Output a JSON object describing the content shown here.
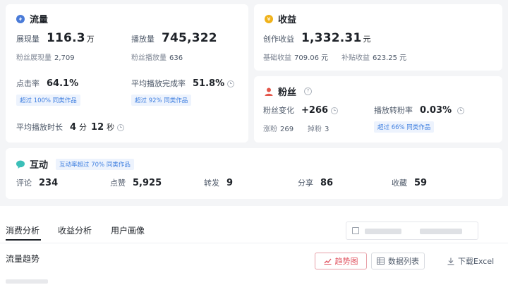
{
  "traffic": {
    "title": "流量",
    "impressions_label": "展现量",
    "impressions_value": "116.3",
    "impressions_unit": "万",
    "plays_label": "播放量",
    "plays_value": "745,322",
    "fan_impressions_label": "粉丝展现量",
    "fan_impressions_value": "2,709",
    "fan_plays_label": "粉丝播放量",
    "fan_plays_value": "636",
    "ctr_label": "点击率",
    "ctr_value": "64.1%",
    "ctr_badge": "超过 100% 同类作品",
    "completion_label": "平均播放完成率",
    "completion_value": "51.8%",
    "completion_badge": "超过 92% 同类作品",
    "avg_duration_label": "平均播放时长",
    "avg_duration_min": "4",
    "avg_duration_min_unit": "分",
    "avg_duration_sec": "12",
    "avg_duration_sec_unit": "秒"
  },
  "income": {
    "title": "收益",
    "creation_label": "创作收益",
    "creation_value": "1,332.31",
    "creation_unit": "元",
    "base_label": "基础收益",
    "base_value": "709.06 元",
    "subsidy_label": "补贴收益",
    "subsidy_value": "623.25 元"
  },
  "fans": {
    "title": "粉丝",
    "change_label": "粉丝变化",
    "change_value": "+266",
    "conversion_label": "播放转粉率",
    "conversion_value": "0.03%",
    "conversion_badge": "超过 66% 同类作品",
    "gain_label": "涨粉",
    "gain_value": "269",
    "loss_label": "掉粉",
    "loss_value": "3"
  },
  "interaction": {
    "title": "互动",
    "badge": "互动率超过 70% 同类作品",
    "items": [
      {
        "label": "评论",
        "value": "234"
      },
      {
        "label": "点赞",
        "value": "5,925"
      },
      {
        "label": "转发",
        "value": "9"
      },
      {
        "label": "分享",
        "value": "86"
      },
      {
        "label": "收藏",
        "value": "59"
      }
    ]
  },
  "tabs": [
    "消费分析",
    "收益分析",
    "用户画像"
  ],
  "trend": {
    "title": "流量趋势",
    "chart_button": "趋势图",
    "list_button": "数据列表",
    "download_button": "下载Excel"
  },
  "colors": {
    "traffic_icon": "#4a7bd8",
    "income_icon": "#f0b21a",
    "fans_icon": "#e4564a",
    "interaction_icon": "#3bbfb8",
    "badge_text": "#3f7fe0",
    "active_button": "#e0525f"
  }
}
